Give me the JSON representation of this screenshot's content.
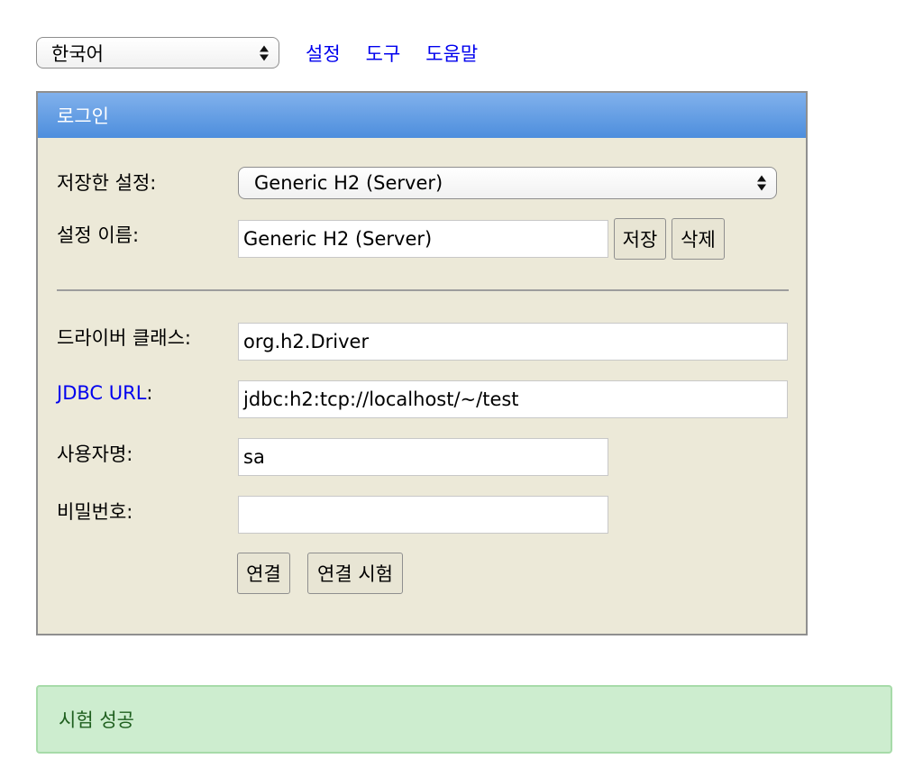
{
  "topbar": {
    "language": "한국어",
    "links": [
      "설정",
      "도구",
      "도움말"
    ]
  },
  "login": {
    "title": "로그인",
    "saved_settings_label": "저장한 설정:",
    "saved_settings_value": "Generic H2 (Server)",
    "setting_name_label": "설정 이름:",
    "setting_name_value": "Generic H2 (Server)",
    "save_button": "저장",
    "delete_button": "삭제",
    "driver_class_label": "드라이버 클래스:",
    "driver_class_value": "org.h2.Driver",
    "jdbc_url_link": "JDBC URL",
    "jdbc_url_colon": ":",
    "jdbc_url_value": "jdbc:h2:tcp://localhost/~/test",
    "username_label": "사용자명:",
    "username_value": "sa",
    "password_label": "비밀번호:",
    "password_value": "",
    "connect_button": "연결",
    "test_connection_button": "연결 시험"
  },
  "status": {
    "message": "시험 성공"
  },
  "colors": {
    "header_gradient_top": "#81b1ec",
    "header_gradient_bottom": "#4d8edd",
    "panel_background": "#ece9d8",
    "link": "#0000ee",
    "success_background": "#cdedcf",
    "success_text": "#1f5f1f"
  }
}
